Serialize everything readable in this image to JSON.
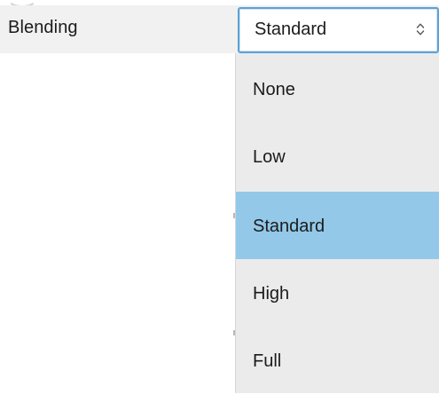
{
  "setting": {
    "label": "Blending",
    "selected_value": "Standard"
  },
  "dropdown": {
    "options": [
      {
        "label": "None",
        "selected": false
      },
      {
        "label": "Low",
        "selected": false
      },
      {
        "label": "Standard",
        "selected": true
      },
      {
        "label": "High",
        "selected": false
      },
      {
        "label": "Full",
        "selected": false
      }
    ]
  },
  "icons": {
    "select_arrows": "up-down-chevron-icon"
  },
  "colors": {
    "row_background": "#f1f1f1",
    "select_border": "#5ea1d6",
    "dropdown_background": "#ebebeb",
    "selected_highlight": "#93c8e8"
  }
}
